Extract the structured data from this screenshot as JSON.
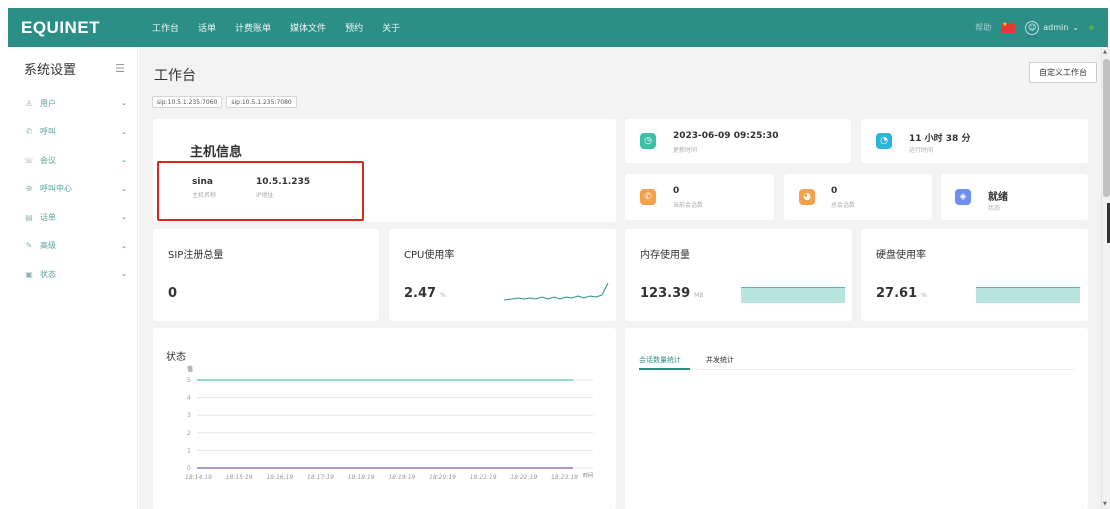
{
  "brand": {
    "logo": "EQUINET",
    "bar_color": "#2b8f87"
  },
  "nav": [
    "工作台",
    "话单",
    "计费账单",
    "媒体文件",
    "预约",
    "关于"
  ],
  "top_right": {
    "help": "帮助",
    "user": "admin"
  },
  "sidebar": {
    "title": "系统设置",
    "items": [
      {
        "label": "用户",
        "icon": "user-icon",
        "glyph": "♙"
      },
      {
        "label": "呼叫",
        "icon": "phone-icon",
        "glyph": "✆"
      },
      {
        "label": "会议",
        "icon": "meeting-icon",
        "glyph": "☏"
      },
      {
        "label": "呼叫中心",
        "icon": "callcenter-icon",
        "glyph": "⊕"
      },
      {
        "label": "话单",
        "icon": "record-icon",
        "glyph": "▤"
      },
      {
        "label": "高级",
        "icon": "tool-icon",
        "glyph": "✎"
      },
      {
        "label": "状态",
        "icon": "status-icon",
        "glyph": "▣"
      }
    ]
  },
  "page": {
    "title": "工作台",
    "custom_button": "自定义工作台"
  },
  "sip_tags": [
    "sip:10.5.1.235:7060",
    "sip:10.5.1.235:7080"
  ],
  "host": {
    "title": "主机信息",
    "name_value": "sina",
    "name_label": "主机名称",
    "ip_value": "10.5.1.235",
    "ip_label": "IP地址"
  },
  "stats": {
    "update_time": {
      "value": "2023-06-09 09:25:30",
      "label": "更新时间",
      "color": "#3dbfa8"
    },
    "uptime": {
      "value": "11 小时 38 分",
      "label": "运行时间",
      "color": "#2bb6d8"
    },
    "current_sessions": {
      "value": "0",
      "label": "当前会话数",
      "color": "#f5a04a"
    },
    "total_sessions": {
      "value": "0",
      "label": "总会话数",
      "color": "#f5a04a"
    },
    "status": {
      "value": "就绪",
      "label": "状态",
      "color": "#6e8ef0"
    }
  },
  "metrics": {
    "sip_total": {
      "title": "SIP注册总量",
      "value": "0"
    },
    "cpu": {
      "title": "CPU使用率",
      "value": "2.47",
      "unit": "%"
    },
    "memory": {
      "title": "内存使用量",
      "value": "123.39",
      "unit": "MB"
    },
    "disk": {
      "title": "硬盘使用率",
      "value": "27.61",
      "unit": "%"
    }
  },
  "state_section": {
    "title": "状态"
  },
  "right_tabs": [
    "会话数量统计",
    "并发统计"
  ],
  "chart_data": {
    "type": "line",
    "ylabel": "值",
    "xlabel": "时间",
    "ylim": [
      0,
      5
    ],
    "y_ticks": [
      "5",
      "4",
      "3",
      "2",
      "1",
      "0"
    ],
    "x": [
      "18:14:19",
      "18:15:19",
      "18:16:19",
      "18:17:19",
      "18:18:19",
      "18:19:19",
      "18:20:19",
      "18:21:19",
      "18:22:19",
      "18:23:19"
    ],
    "series": [
      {
        "color": "#4fc2b4",
        "values": [
          5,
          5,
          5,
          5,
          5,
          5,
          5,
          5,
          5,
          5
        ]
      },
      {
        "color": "#7b5fa8",
        "values": [
          0,
          0,
          0,
          0,
          0,
          0,
          0,
          0,
          0,
          0
        ]
      }
    ]
  }
}
